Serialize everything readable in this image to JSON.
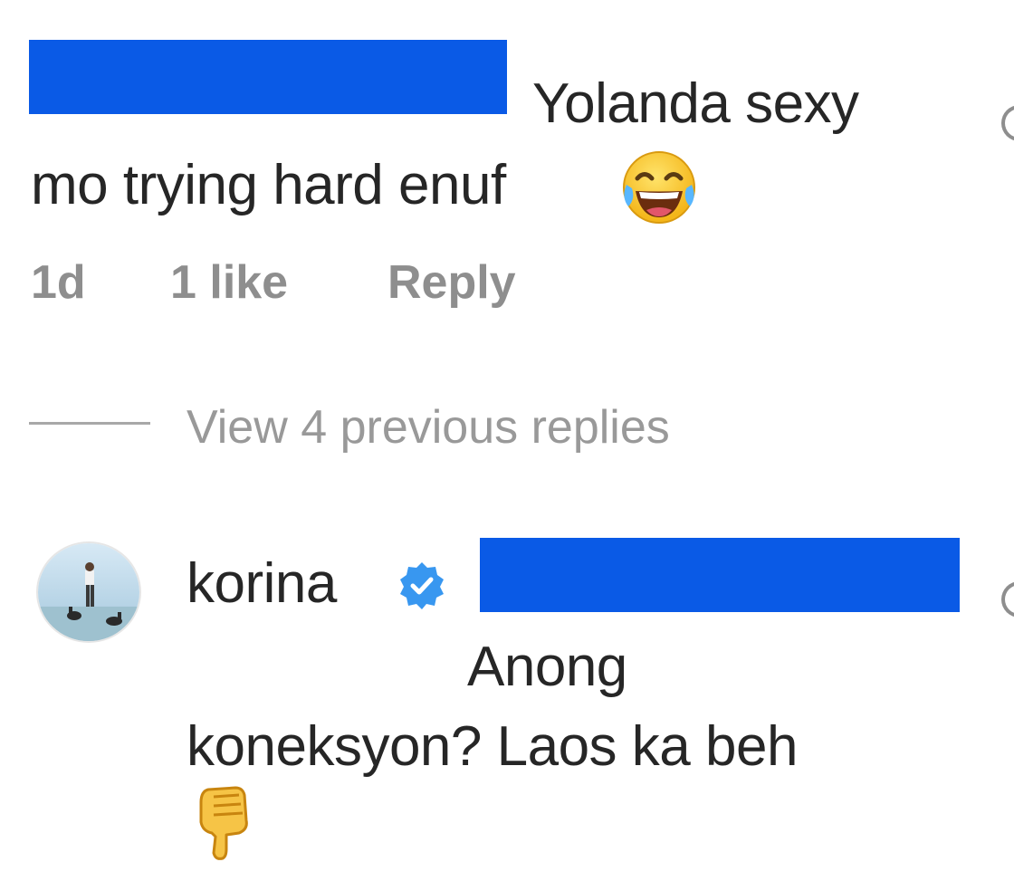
{
  "comment1": {
    "text_line1": "Yolanda sexy",
    "text_line2": "mo trying hard enuf",
    "emoji": "tears-of-joy-emoji",
    "time": "1d",
    "likes": "1 like",
    "reply_label": "Reply"
  },
  "replies_toggle": {
    "label": "View 4 previous replies"
  },
  "reply": {
    "username": "korina",
    "verified_badge": "verified-badge-icon",
    "text_line1": "Anong",
    "text_line2": "koneksyon? Laos ka beh",
    "emoji": "thumbs-down-emoji"
  },
  "colors": {
    "redaction": "#0a5ae6",
    "verified": "#3897f0",
    "meta_text": "#8e8e8e",
    "primary_text": "#262626"
  }
}
